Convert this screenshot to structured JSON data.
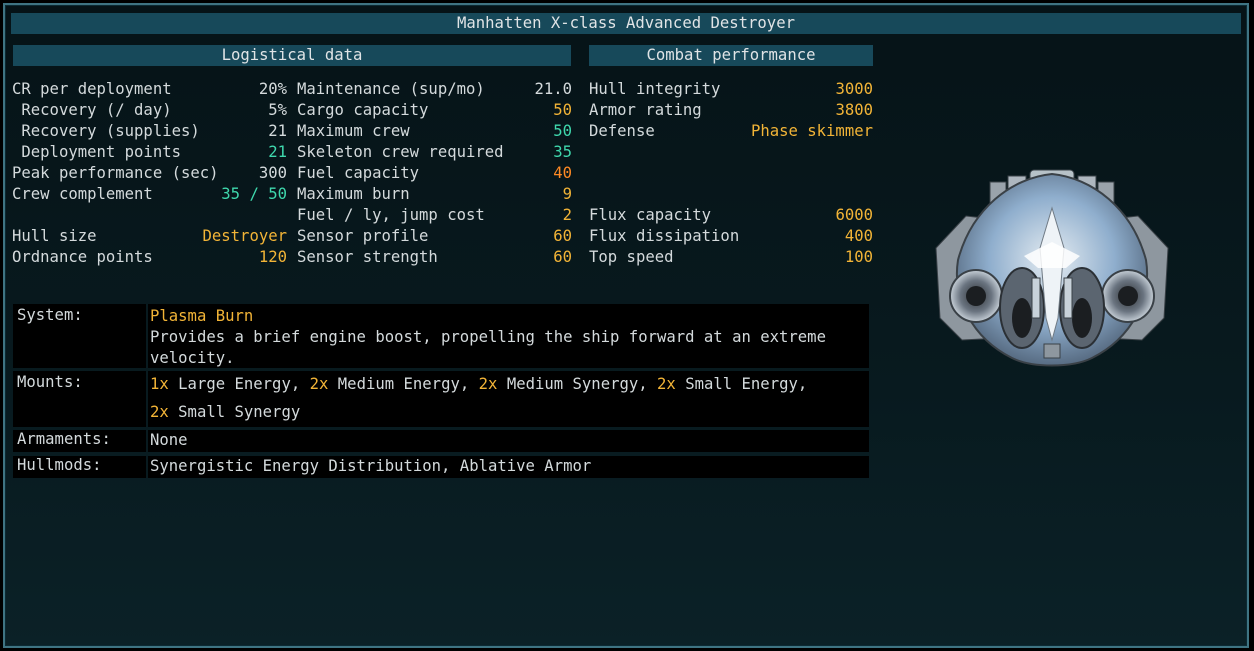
{
  "window": {
    "title": "Manhatten X-class Advanced Destroyer"
  },
  "logistics": {
    "header": "Logistical data",
    "col1": [
      {
        "label": "CR per deployment",
        "value": "20%",
        "color": "white"
      },
      {
        "label": " Recovery (/ day)",
        "value": "5%",
        "color": "white"
      },
      {
        "label": " Recovery (supplies)",
        "value": "21",
        "color": "white"
      },
      {
        "label": " Deployment points",
        "value": "21",
        "color": "teal"
      },
      {
        "label": "Peak performance (sec)",
        "value": "300",
        "color": "white"
      },
      {
        "label": "Crew complement",
        "value": "35 / 50",
        "color": "teal"
      },
      {
        "label": "Hull size",
        "value": "Destroyer",
        "color": "gold"
      },
      {
        "label": "Ordnance points",
        "value": "120",
        "color": "gold"
      }
    ],
    "col2": [
      {
        "label": "Maintenance (sup/mo)",
        "value": "21.0",
        "color": "white"
      },
      {
        "label": "Cargo capacity",
        "value": "50",
        "color": "gold"
      },
      {
        "label": "Maximum crew",
        "value": "50",
        "color": "teal"
      },
      {
        "label": "Skeleton crew required",
        "value": "35",
        "color": "teal"
      },
      {
        "label": "Fuel capacity",
        "value": "40",
        "color": "orange"
      },
      {
        "label": "Maximum burn",
        "value": "9",
        "color": "gold"
      },
      {
        "label": "Fuel / ly, jump cost",
        "value": "2",
        "color": "gold"
      },
      {
        "label": "Sensor profile",
        "value": "60",
        "color": "gold"
      },
      {
        "label": "Sensor strength",
        "value": "60",
        "color": "gold"
      }
    ]
  },
  "combat": {
    "header": "Combat performance",
    "rows": [
      {
        "label": "Hull integrity",
        "value": "3000",
        "color": "gold"
      },
      {
        "label": "Armor rating",
        "value": "3800",
        "color": "gold"
      },
      {
        "label": "Defense",
        "value": "Phase skimmer",
        "color": "gold"
      },
      {
        "label": "Flux capacity",
        "value": "6000",
        "color": "gold"
      },
      {
        "label": "Flux dissipation",
        "value": "400",
        "color": "gold"
      },
      {
        "label": "Top speed",
        "value": "100",
        "color": "gold"
      }
    ]
  },
  "details": {
    "system": {
      "label": "System:",
      "name": "Plasma Burn",
      "description": "Provides a brief engine boost, propelling the ship forward at an extreme velocity."
    },
    "mounts": {
      "label": "Mounts:",
      "items": [
        {
          "count": "1x",
          "name": "Large Energy"
        },
        {
          "count": "2x",
          "name": "Medium Energy"
        },
        {
          "count": "2x",
          "name": "Medium Synergy"
        },
        {
          "count": "2x",
          "name": "Small Energy"
        },
        {
          "count": "2x",
          "name": "Small Synergy"
        }
      ]
    },
    "armaments": {
      "label": "Armaments:",
      "value": "None"
    },
    "hullmods": {
      "label": "Hullmods:",
      "value": "Synergistic Energy Distribution, Ablative Armor"
    }
  },
  "ship_image": {
    "icon": "ship-sprite-icon",
    "colors": {
      "hull": "#b7c2c8",
      "accent": "#7da7d8",
      "dark": "#3a4147"
    }
  },
  "colors": {
    "white": "#d4dadc",
    "teal": "#3fd8ad",
    "gold": "#f2b437",
    "orange": "#ff8a24",
    "yellow": "#f4dc3a",
    "header": "#17495a",
    "border": "#3f7483"
  }
}
